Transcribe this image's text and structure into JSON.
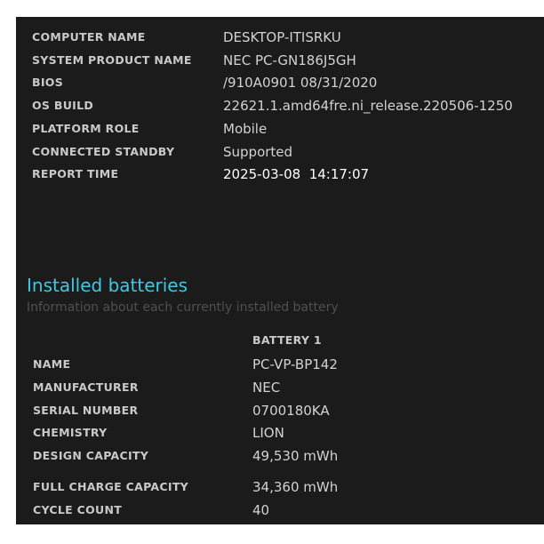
{
  "system_info": [
    {
      "key": "COMPUTER NAME",
      "value": "DESKTOP-ITISRKU"
    },
    {
      "key": "SYSTEM PRODUCT NAME",
      "value": "NEC PC-GN186J5GH"
    },
    {
      "key": "BIOS",
      "value": "/910A0901 08/31/2020"
    },
    {
      "key": "OS BUILD",
      "value": "22621.1.amd64fre.ni_release.220506-1250"
    },
    {
      "key": "PLATFORM ROLE",
      "value": "Mobile"
    },
    {
      "key": "CONNECTED STANDBY",
      "value": "Supported"
    },
    {
      "key": "REPORT TIME",
      "value": "2025-03-08  14:17:07"
    }
  ],
  "installed_batteries": {
    "title": "Installed batteries",
    "subtitle": "Information about each currently installed battery",
    "column_header": "BATTERY 1",
    "rows": [
      {
        "key": "NAME",
        "value": "PC-VP-BP142"
      },
      {
        "key": "MANUFACTURER",
        "value": "NEC"
      },
      {
        "key": "SERIAL NUMBER",
        "value": "0700180KA"
      },
      {
        "key": "CHEMISTRY",
        "value": "LION"
      },
      {
        "key": "DESIGN CAPACITY",
        "value": "49,530 mWh"
      },
      {
        "key": "FULL CHARGE CAPACITY",
        "value": "34,360 mWh"
      },
      {
        "key": "CYCLE COUNT",
        "value": "40"
      }
    ]
  },
  "colors": {
    "background": "#1b1b1b",
    "section_title": "#3ec9e0",
    "subtitle": "#4f4f4f",
    "label": "#c9c9c9",
    "value": "#d2d2d2"
  }
}
